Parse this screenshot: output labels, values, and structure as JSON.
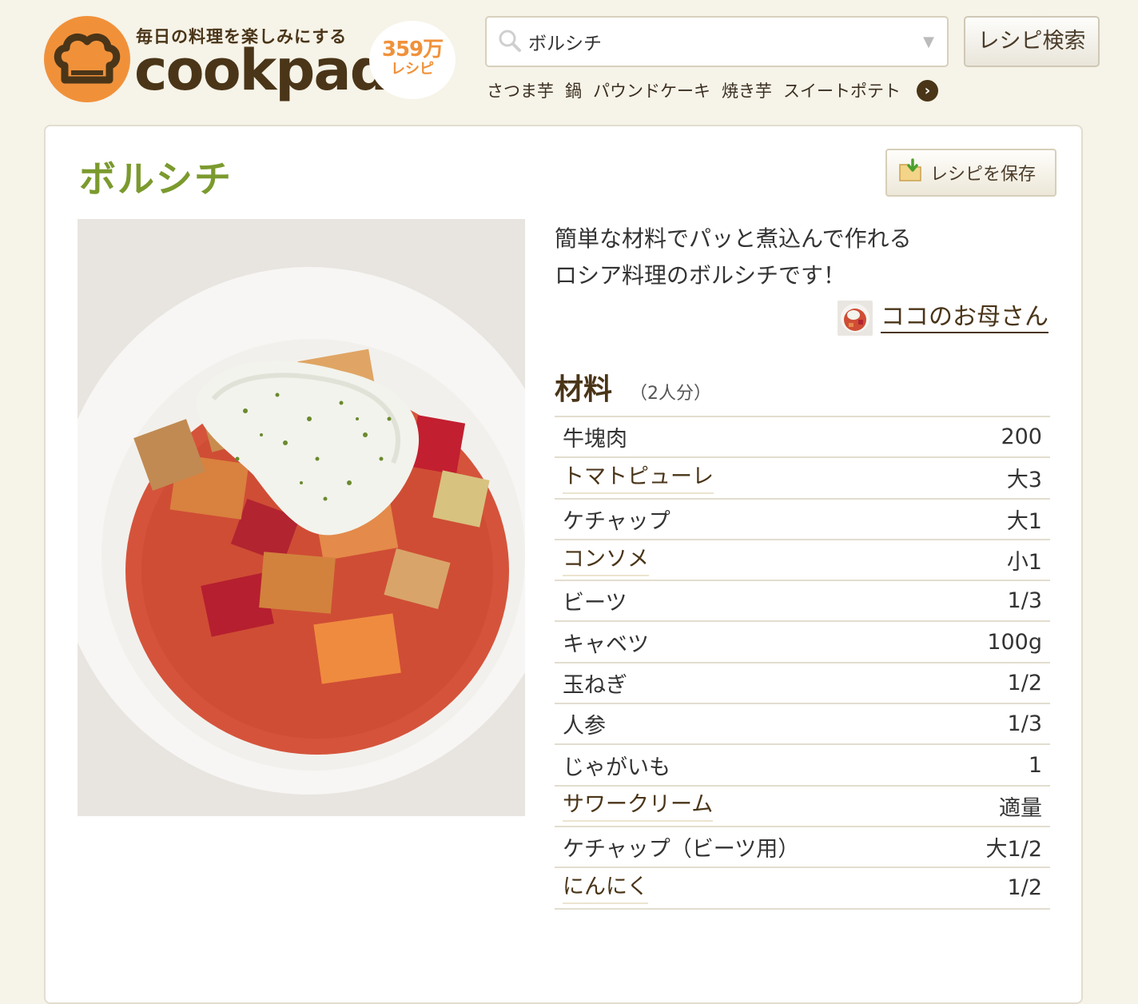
{
  "header": {
    "tagline": "毎日の料理を楽しみにする",
    "wordmark": "cookpad",
    "recipe_count": "359万",
    "recipe_count_label": "レシピ",
    "search": {
      "value": "ボルシチ",
      "placeholder": ""
    },
    "search_button": "レシピ検索",
    "keywords": [
      "さつま芋",
      "鍋",
      "パウンドケーキ",
      "焼き芋",
      "スイートポテト"
    ]
  },
  "recipe": {
    "title": "ボルシチ",
    "save_button": "レシピを保存",
    "description_lines": [
      "簡単な材料でパッと煮込んで作れる",
      "ロシア料理のボルシチです！"
    ],
    "author": "ココのお母さん",
    "ingredients_heading": "材料",
    "servings": "（2人分）",
    "ingredients": [
      {
        "name": "牛塊肉",
        "qty": "200"
      },
      {
        "name": "トマトピューレ",
        "qty": "大3"
      },
      {
        "name": "ケチャップ",
        "qty": "大1"
      },
      {
        "name": "コンソメ",
        "qty": "小1"
      },
      {
        "name": "ビーツ",
        "qty": "1/3"
      },
      {
        "name": "キャベツ",
        "qty": "100g"
      },
      {
        "name": "玉ねぎ",
        "qty": "1/2"
      },
      {
        "name": "人参",
        "qty": "1/3"
      },
      {
        "name": "じゃがいも",
        "qty": "1"
      },
      {
        "name": "サワークリーム",
        "qty": "適量"
      },
      {
        "name": "ケチャップ（ビーツ用）",
        "qty": "大1/2"
      },
      {
        "name": "にんにく",
        "qty": "1/2"
      }
    ]
  },
  "colors": {
    "brand_orange": "#f0913a",
    "title_green": "#7b9a2e",
    "brown": "#4a3518"
  }
}
